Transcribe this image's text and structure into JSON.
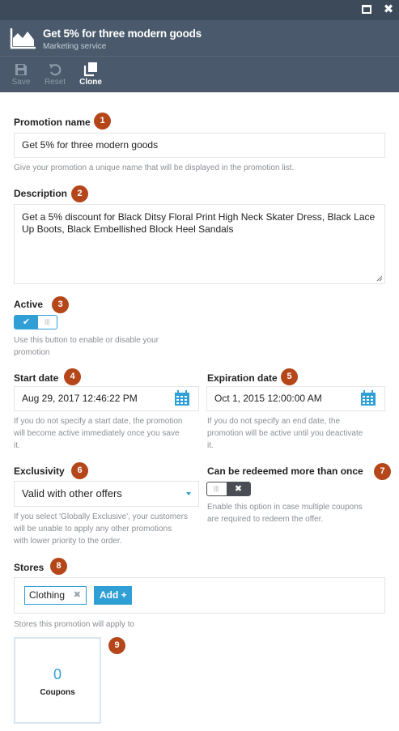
{
  "window": {
    "controls": [
      "maximize-icon",
      "close-icon"
    ],
    "close_glyph": "✖"
  },
  "header": {
    "title": "Get 5% for three modern goods",
    "subtitle": "Marketing service",
    "icon": "chart-area-icon"
  },
  "toolbar": {
    "save_label": "Save",
    "reset_label": "Reset",
    "clone_label": "Clone"
  },
  "form": {
    "promotion_name": {
      "label": "Promotion name",
      "badge": "1",
      "value": "Get 5% for three modern goods",
      "help": "Give your promotion a unique name that will be displayed in the promotion list."
    },
    "description": {
      "label": "Description",
      "badge": "2",
      "value": "Get a 5% discount for Black Ditsy Floral Print High Neck Skater Dress, Black Lace Up Boots, Black Embellished Block Heel Sandals"
    },
    "active": {
      "label": "Active",
      "badge": "3",
      "checked": true,
      "on_glyph": "✔",
      "help_line1": "Use this button to enable or disable your",
      "help_line2": "promotion"
    },
    "start_date": {
      "label": "Start date",
      "badge": "4",
      "value": "Aug 29, 2017 12:46:22 PM",
      "help_line1": "If you do not specify a start date, the promotion",
      "help_line2": "will become active immediately once you save",
      "help_line3": "it."
    },
    "expiration_date": {
      "label": "Expiration date",
      "badge": "5",
      "value": "Oct 1, 2015 12:00:00 AM",
      "help_line1": "If you do not specify an end date, the",
      "help_line2": "promotion will be active until you deactivate",
      "help_line3": "it."
    },
    "exclusivity": {
      "label": "Exclusivity",
      "badge": "6",
      "selected": "Valid with other offers",
      "help_line1": "If you select 'Globally Exclusive', your customers",
      "help_line2": "will be unable to apply any other promotions",
      "help_line3": "with lower priority to the order."
    },
    "redeem_multiple": {
      "label": "Can be redeemed more than once",
      "badge": "7",
      "checked": false,
      "off_glyph": "✖",
      "help_line1": "Enable this option in case multiple coupons",
      "help_line2": "are required to redeem the offer."
    },
    "stores": {
      "label": "Stores",
      "badge": "8",
      "chips": [
        {
          "label": "Clothing",
          "remove_glyph": "✖"
        }
      ],
      "add_label": "Add +",
      "help": "Stores this promotion will apply to"
    },
    "coupons": {
      "badge": "9",
      "count": "0",
      "label": "Coupons"
    }
  },
  "colors": {
    "titlebar": "#3c4a5a",
    "header": "#4a5a6c",
    "accent": "#2f9fd6",
    "badge": "#b5461a",
    "toggle_off": "#4a4e54"
  }
}
